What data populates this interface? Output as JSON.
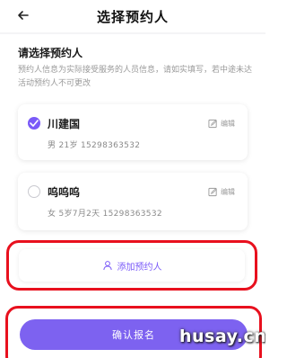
{
  "header": {
    "title": "选择预约人",
    "back_icon": "arrow-left-icon"
  },
  "section": {
    "title": "请选择预约人",
    "notice": "预约人信息为实际接受服务的人员信息，请如实填写，若中途未达活动预约人不可更改"
  },
  "participants": [
    {
      "name": "川建国",
      "detail": "男  21岁  15298363532",
      "selected": true,
      "edit_label": "编辑"
    },
    {
      "name": "呜呜呜",
      "detail": "女  5岁7月2天  15298363532",
      "selected": false,
      "edit_label": "编辑"
    }
  ],
  "add_button": {
    "label": "添加预约人",
    "icon": "user-icon"
  },
  "confirm_button": {
    "label": "确认报名"
  },
  "watermark": "husay.cn",
  "colors": {
    "accent": "#7a5af8",
    "highlight": "#e8101e"
  }
}
